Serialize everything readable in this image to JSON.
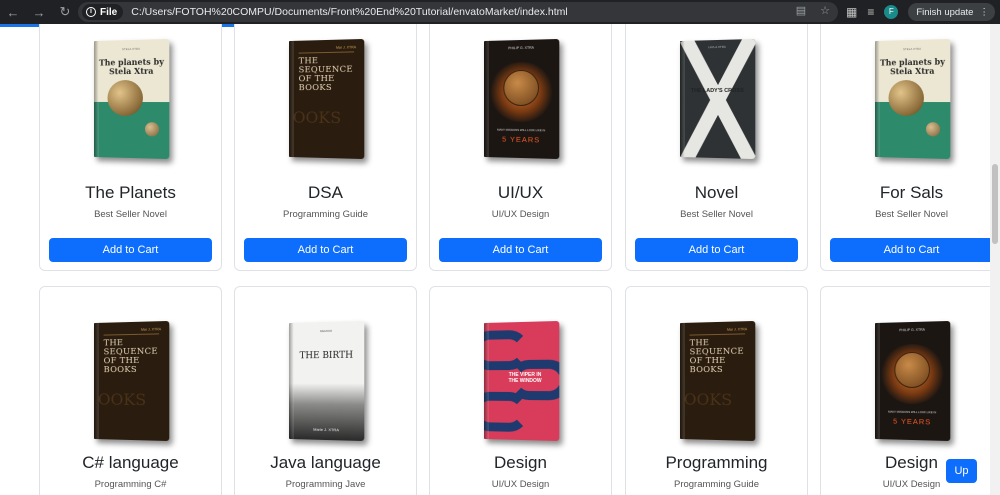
{
  "browser": {
    "file_chip": "File",
    "url": "C:/Users/FOTOH%20COMPU/Documents/Front%20End%20Tutorial/envatoMarket/index.html",
    "update_label": "Finish update",
    "profile_initial": "F"
  },
  "cart_label": "Add to Cart",
  "up_label": "Up",
  "row1": [
    {
      "title": "The Planets",
      "subtitle": "Best Seller Novel",
      "cover": {
        "title": "The planets by Stela Xtra"
      }
    },
    {
      "title": "DSA",
      "subtitle": "Programming Guide",
      "cover": {
        "title": "THE SEQUENCE OF THE BOOKS"
      }
    },
    {
      "title": "UI/UX",
      "subtitle": "UI/UX Design",
      "cover": {
        "title": "5 YEARS"
      }
    },
    {
      "title": "Novel",
      "subtitle": "Best Seller Novel",
      "cover": {
        "title": "THE LADY'S CROSS"
      }
    },
    {
      "title": "For Sals",
      "subtitle": "Best Seller Novel",
      "cover": {
        "title": "The planets by Stela Xtra"
      }
    }
  ],
  "row2": [
    {
      "title": "C# language",
      "subtitle": "Programming C#",
      "cover": {
        "title": "THE SEQUENCE OF THE BOOKS"
      }
    },
    {
      "title": "Java language",
      "subtitle": "Programming Jave",
      "cover": {
        "title": "THE BIRTH",
        "author": "Marie J. XTRA"
      }
    },
    {
      "title": "Design",
      "subtitle": "UI/UX Design",
      "cover": {
        "title": "THE VIPER IN THE WINDOW"
      }
    },
    {
      "title": "Programming",
      "subtitle": "Programming Guide",
      "cover": {
        "title": "THE SEQUENCE OF THE BOOKS"
      }
    },
    {
      "title": "Design",
      "subtitle": "UI/UX Design",
      "cover": {
        "title": "5 YEARS"
      }
    }
  ]
}
